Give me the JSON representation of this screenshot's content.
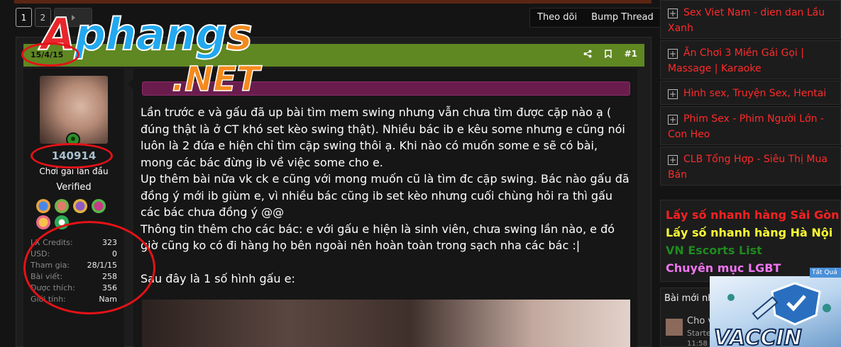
{
  "pagination": {
    "pages": [
      "1",
      "2"
    ],
    "current": "1"
  },
  "thread_actions": {
    "follow": "Theo dõi",
    "bump": "Bump Thread"
  },
  "logo": {
    "main": "Aphangs",
    "sub": ".NET"
  },
  "post": {
    "date": "15/4/15",
    "number": "#1",
    "author": {
      "name": "140914",
      "title": "Chơi gái lần đầu",
      "status": "Verified",
      "stats": [
        {
          "label": "LX Credits:",
          "value": "323"
        },
        {
          "label": "USD:",
          "value": "0"
        },
        {
          "label": "Tham gia:",
          "value": "28/1/15"
        },
        {
          "label": "Bài viết:",
          "value": "258"
        },
        {
          "label": "Được thích:",
          "value": "356"
        },
        {
          "label": "Giới tính:",
          "value": "Nam"
        }
      ]
    },
    "body": [
      "Lần trước e và gấu đã up bài tìm mem swing nhưng vẫn chưa tìm được cặp nào ạ ( đúng thật là ở CT khó set kèo swing thật). Nhiều bác ib e kêu some nhưng e cũng nói luôn là 2 đứa e hiện chỉ tìm cặp swing thôi ạ. Khi nào có muốn some e sẽ có bài, mong các bác đừng ib về việc some cho e.",
      "Up thêm bài nữa vk ck e cũng với mong muốn cũ là tìm đc cặp swing. Bác nào gấu đã đồng ý mới ib giùm e, vì nhiều bác cũng ib set kèo nhưng cuối chùng hỏi ra thì gấu các bác chưa đồng ý @@",
      "Thông tin thêm cho các bác: e với gấu e hiện là sinh viên, chưa swing lần nào, e đó giờ cũng ko có đi hàng họ bên ngoài nên hoàn toàn trong sạch nha các bác :|",
      "",
      "Sau đây là 1 số hình gấu e:"
    ]
  },
  "sidebar": {
    "links": [
      "Sex Viet Nam - dien dan Lầu Xanh",
      "Ăn Chơi 3 Miền Gái Gọi | Massage | Karaoke",
      "Hình sex, Truyện Sex, Hentai",
      "Phim Sex - Phim Người Lớn - Con Heo",
      "CLB Tổng Hợp - Siêu Thị Mua Bán"
    ],
    "quick_links": [
      {
        "label": "Lấy số nhanh hàng Sài Gòn",
        "color": "#ff2020"
      },
      {
        "label": "Lấy số nhanh hàng Hà Nội",
        "color": "#ffff33"
      },
      {
        "label": "VN Escorts List",
        "color": "#1f8a1f"
      },
      {
        "label": "Chuyên mục LGBT",
        "color": "#f075f0"
      }
    ],
    "new_posts": {
      "title": "Bài mới nh",
      "item_title": "Cho v",
      "item_sub": "Starte",
      "item_time": "11:58"
    },
    "ad": {
      "tag": "Tất Quả",
      "word": "VACCIN"
    }
  }
}
